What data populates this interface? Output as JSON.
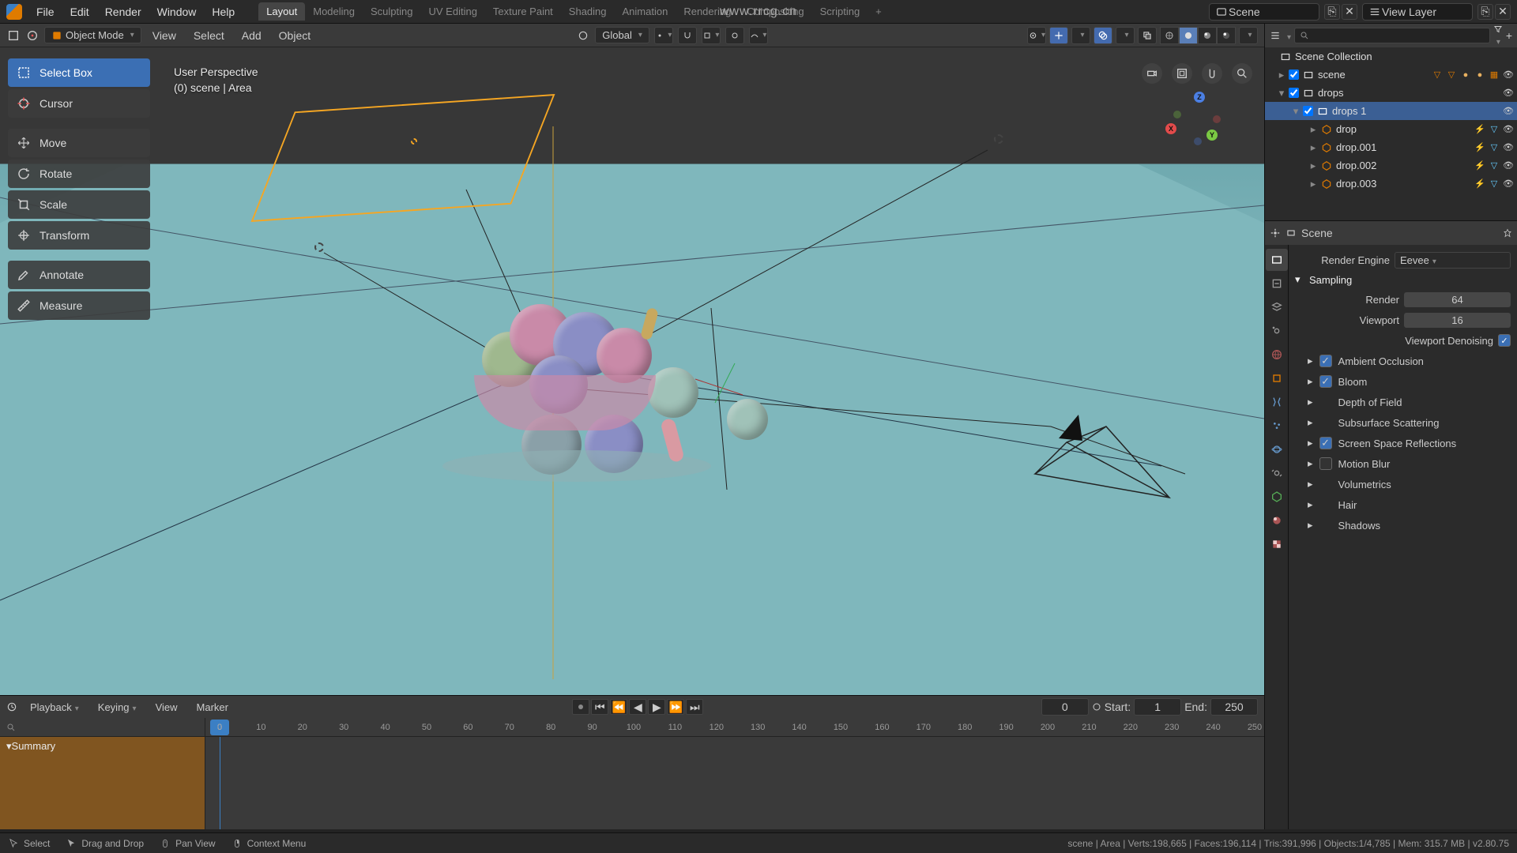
{
  "menu": {
    "file": "File",
    "edit": "Edit",
    "render": "Render",
    "window": "Window",
    "help": "Help"
  },
  "workspaces": [
    "Layout",
    "Modeling",
    "Sculpting",
    "UV Editing",
    "Texture Paint",
    "Shading",
    "Animation",
    "Rendering",
    "Compositing",
    "Scripting"
  ],
  "active_workspace": "Layout",
  "watermark": "www.rrcg.cn",
  "header": {
    "scene_label": "Scene",
    "view_layer_label": "View Layer"
  },
  "viewport_header": {
    "mode": "Object Mode",
    "menus": {
      "view": "View",
      "select": "Select",
      "add": "Add",
      "object": "Object"
    },
    "orientation": "Global"
  },
  "overlay": {
    "perspective": "User Perspective",
    "context": "(0) scene | Area"
  },
  "tools": {
    "select_box": "Select Box",
    "cursor": "Cursor",
    "move": "Move",
    "rotate": "Rotate",
    "scale": "Scale",
    "transform": "Transform",
    "annotate": "Annotate",
    "measure": "Measure"
  },
  "outliner": {
    "scene_collection": "Scene Collection",
    "scene": "scene",
    "drops": "drops",
    "drops1": "drops 1",
    "drop": "drop",
    "drop001": "drop.001",
    "drop002": "drop.002",
    "drop003": "drop.003"
  },
  "properties": {
    "breadcrumb": "Scene",
    "render_engine_lbl": "Render Engine",
    "render_engine_val": "Eevee",
    "sampling": "Sampling",
    "render_lbl": "Render",
    "render_val": "64",
    "viewport_lbl": "Viewport",
    "viewport_val": "16",
    "viewport_denoising": "Viewport Denoising",
    "ao": "Ambient Occlusion",
    "bloom": "Bloom",
    "dof": "Depth of Field",
    "sss": "Subsurface Scattering",
    "ssr": "Screen Space Reflections",
    "motion_blur": "Motion Blur",
    "volumetrics": "Volumetrics",
    "hair": "Hair",
    "shadows": "Shadows"
  },
  "timeline": {
    "playback": "Playback",
    "keying": "Keying",
    "view": "View",
    "marker": "Marker",
    "current": "0",
    "start_lbl": "Start:",
    "start_val": "1",
    "end_lbl": "End:",
    "end_val": "250",
    "summary": "Summary",
    "ticks": [
      "0",
      "10",
      "20",
      "30",
      "40",
      "50",
      "60",
      "70",
      "80",
      "90",
      "100",
      "110",
      "120",
      "130",
      "140",
      "150",
      "160",
      "170",
      "180",
      "190",
      "200",
      "210",
      "220",
      "230",
      "240",
      "250"
    ]
  },
  "status": {
    "select": "Select",
    "drag": "Drag and Drop",
    "pan": "Pan View",
    "ctx": "Context Menu",
    "right": "scene | Area | Verts:198,665 | Faces:196,114 | Tris:391,996 | Objects:1/4,785 | Mem: 315.7 MB | v2.80.75"
  }
}
